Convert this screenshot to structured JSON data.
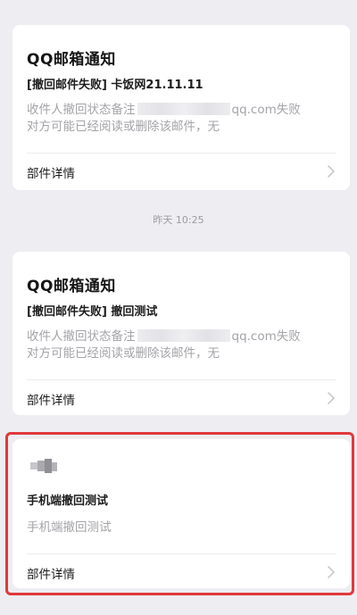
{
  "messages": [
    {
      "title": "QQ邮箱通知",
      "subject": "[撤回邮件失败] 卡饭网21.11.11",
      "body_prefix": "收件人撤回状态备注",
      "body_suffix": "qq.com失败",
      "body_line2": "对方可能已经阅读或删除该邮件，无",
      "detail_label": "部件详情"
    },
    {
      "title": "QQ邮箱通知",
      "subject": "[撤回邮件失败] 撤回测试",
      "body_prefix": "收件人撤回状态备注",
      "body_suffix": "qq.com失败",
      "body_line2": "对方可能已经阅读或删除该邮件，无",
      "detail_label": "部件详情"
    },
    {
      "subject": "手机端撤回测试",
      "body": "手机端撤回测试",
      "detail_label": "部件详情"
    }
  ],
  "timestamp": "昨天 10:25",
  "icons": {
    "chevron": "chevron-right-icon",
    "avatar": "blurred-sender-avatar"
  },
  "colors": {
    "background": "#ededf2",
    "card": "#ffffff",
    "highlight": "#e0383c",
    "muted_text": "#a3a3a8"
  }
}
